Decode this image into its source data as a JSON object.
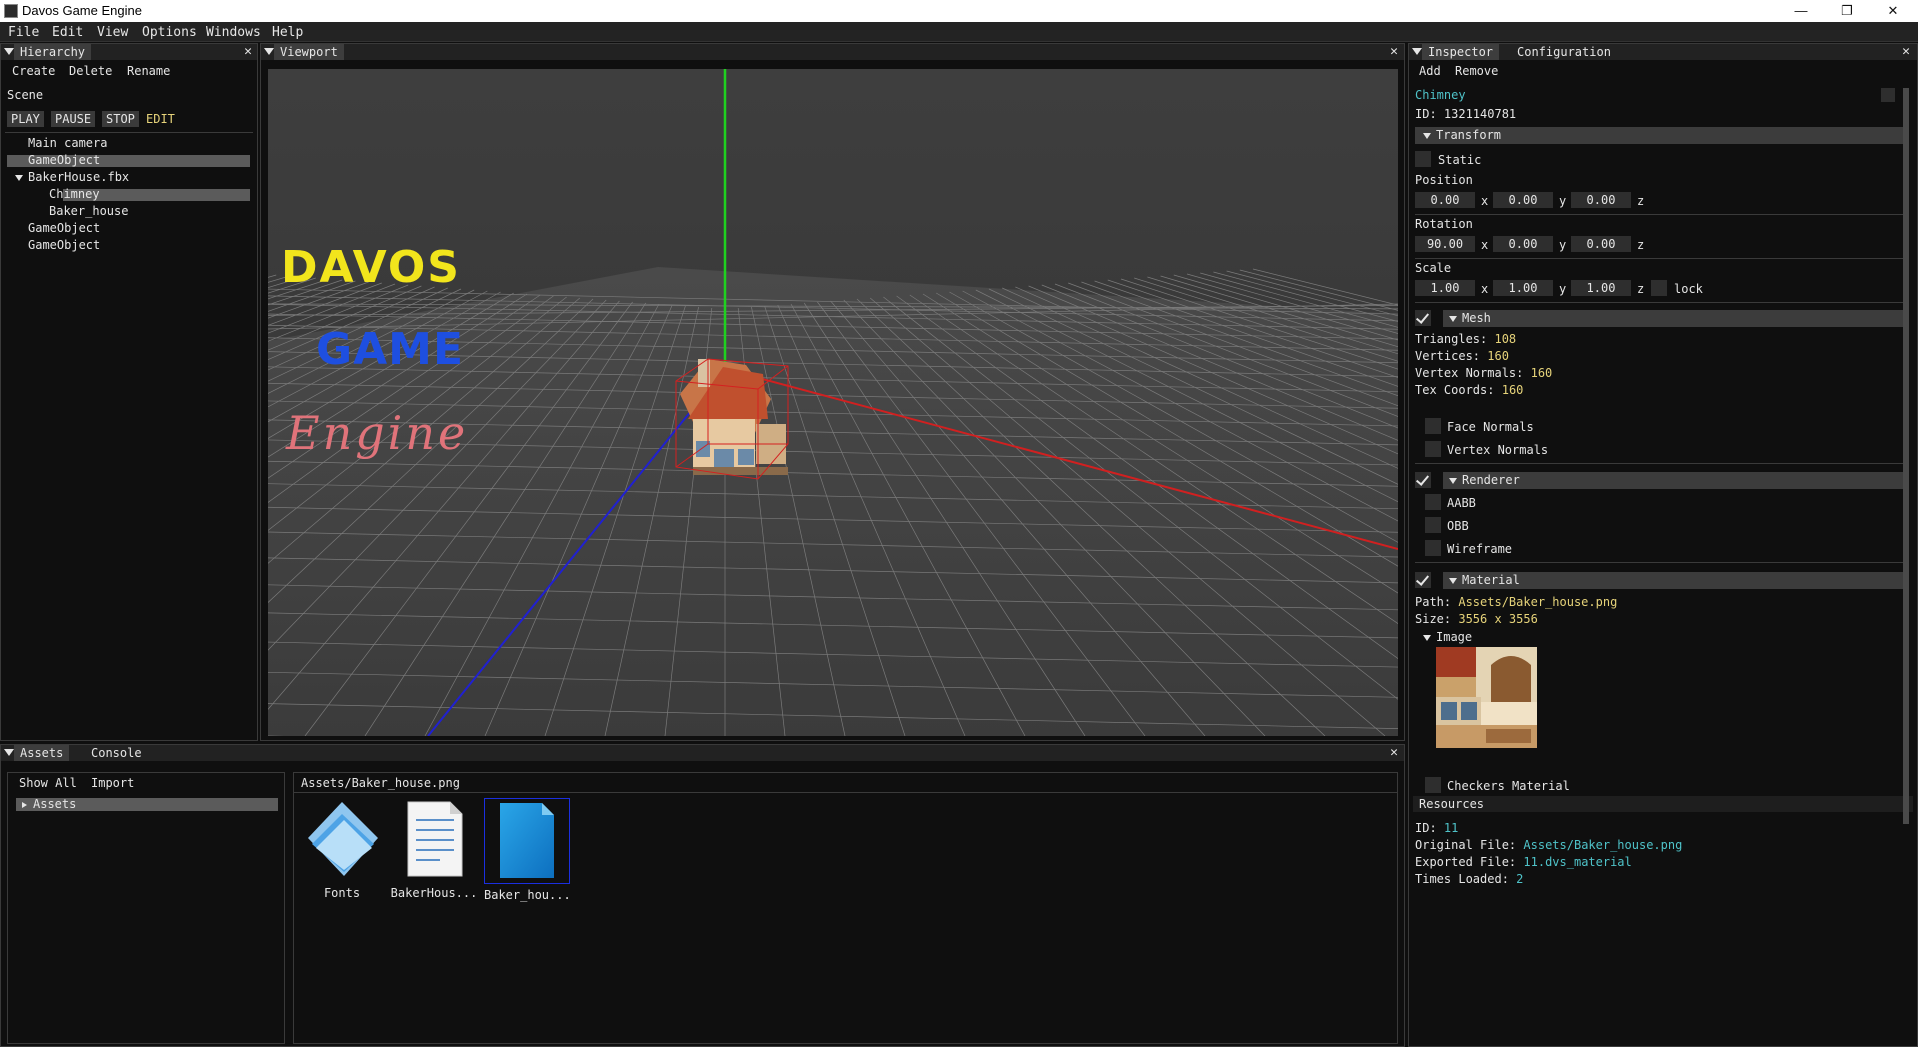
{
  "window": {
    "title": "Davos Game Engine",
    "minimize": "—",
    "restore": "❐",
    "close": "✕"
  },
  "menu": [
    "File",
    "Edit",
    "View",
    "Options",
    "Windows",
    "Help"
  ],
  "hierarchy": {
    "tab": "Hierarchy",
    "actions": [
      "Create",
      "Delete",
      "Rename"
    ],
    "scene_label": "Scene",
    "controls": [
      "PLAY",
      "PAUSE",
      "STOP"
    ],
    "mode": "EDIT",
    "tree": [
      "Main camera",
      "GameObject",
      "BakerHouse.fbx",
      "Chimney",
      "Baker_house",
      "GameObject",
      "GameObject"
    ]
  },
  "viewport": {
    "tab": "Viewport",
    "logo": [
      "DAVOS",
      "GAME",
      "Engine"
    ],
    "colors": {
      "logo_davos": "#f2e51c",
      "logo_game": "#1e4fe0",
      "logo_engine": "#e0737a",
      "axis_y": "#1fd11f",
      "axis_x": "#d12020",
      "axis_z": "#2020d1",
      "aabb": "#d42020"
    }
  },
  "assets": {
    "tabs": [
      "Assets",
      "Console"
    ],
    "actions": [
      "Show All",
      "Import"
    ],
    "tree_root": "Assets",
    "path": "Assets/Baker_house.png",
    "items": [
      {
        "label": "Fonts",
        "icon": "folder-icon"
      },
      {
        "label": "BakerHous...",
        "icon": "document-icon"
      },
      {
        "label": "Baker_hou...",
        "icon": "image-file-icon"
      }
    ]
  },
  "inspector": {
    "tabs": [
      "Inspector",
      "Configuration"
    ],
    "actions": [
      "Add",
      "Remove"
    ],
    "object_name": "Chimney",
    "object_id": "ID: 1321140781",
    "transform": {
      "header": "Transform",
      "static_label": "Static",
      "position_label": "Position",
      "position": [
        "0.00",
        "0.00",
        "0.00"
      ],
      "rotation_label": "Rotation",
      "rotation": [
        "90.00",
        "0.00",
        "0.00"
      ],
      "scale_label": "Scale",
      "scale": [
        "1.00",
        "1.00",
        "1.00"
      ],
      "axes": [
        "x",
        "y",
        "z"
      ],
      "lock_label": "lock"
    },
    "mesh": {
      "header": "Mesh",
      "stats": [
        {
          "label": "Triangles:",
          "value": "108"
        },
        {
          "label": "Vertices:",
          "value": "160"
        },
        {
          "label": "Vertex Normals:",
          "value": "160"
        },
        {
          "label": "Tex Coords:",
          "value": "160"
        }
      ],
      "options": [
        "Face Normals",
        "Vertex Normals"
      ]
    },
    "renderer": {
      "header": "Renderer",
      "options": [
        "AABB",
        "OBB",
        "Wireframe"
      ]
    },
    "material": {
      "header": "Material",
      "path_label": "Path:",
      "path": "Assets/Baker_house.png",
      "size_label": "Size:",
      "size": "3556 x 3556",
      "image_label": "Image",
      "checkers_label": "Checkers Material"
    },
    "resources": {
      "header": "Resources",
      "rows": [
        {
          "label": "ID:",
          "value": "11"
        },
        {
          "label": "Original File:",
          "value": "Assets/Baker_house.png"
        },
        {
          "label": "Exported File:",
          "value": "11.dvs_material"
        },
        {
          "label": "Times Loaded:",
          "value": "2"
        }
      ]
    }
  }
}
